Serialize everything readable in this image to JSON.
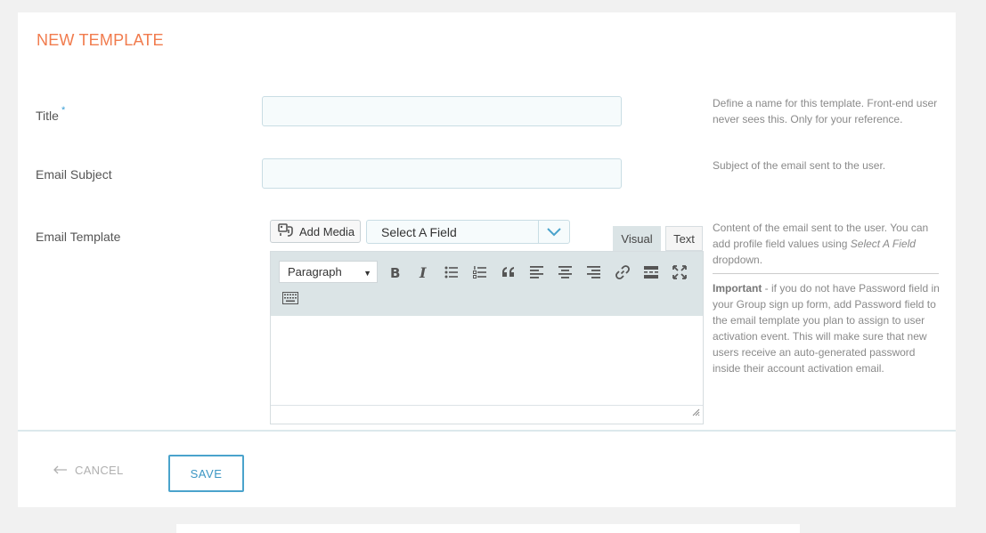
{
  "page": {
    "title": "NEW TEMPLATE"
  },
  "form": {
    "title": {
      "label": "Title",
      "required_mark": "*",
      "value": "",
      "help": "Define a name for this template. Front-end user never sees this. Only for your reference."
    },
    "subject": {
      "label": "Email Subject",
      "value": "",
      "help": "Subject of the email sent to the user."
    },
    "template": {
      "label": "Email Template",
      "add_media_label": "Add Media",
      "select_field_value": "Select A Field",
      "tabs": {
        "visual": "Visual",
        "text": "Text"
      },
      "format_select": "Paragraph",
      "help_part1": "Content of the email sent to the user. You can add profile field values using ",
      "help_italic": "Select A Field",
      "help_part2": " dropdown.",
      "important_label": "Important",
      "important_text": " - if you do not have Password field in your Group sign up form, add Password field to the email template you plan to assign to user activation event. This will make sure that new users receive an auto-generated password inside their account activation email."
    }
  },
  "toolbar_icons": [
    "bold-icon",
    "italic-icon",
    "bullet-list-icon",
    "numbered-list-icon",
    "blockquote-icon",
    "align-left-icon",
    "align-center-icon",
    "align-right-icon",
    "link-icon",
    "read-more-icon",
    "fullscreen-icon",
    "toolbar-toggle-icon"
  ],
  "footer": {
    "cancel_label": "CANCEL",
    "save_label": "SAVE"
  },
  "colors": {
    "title": "#f17b4d",
    "accent": "#4aa3cc",
    "toolbar": "#dbe4e6"
  }
}
